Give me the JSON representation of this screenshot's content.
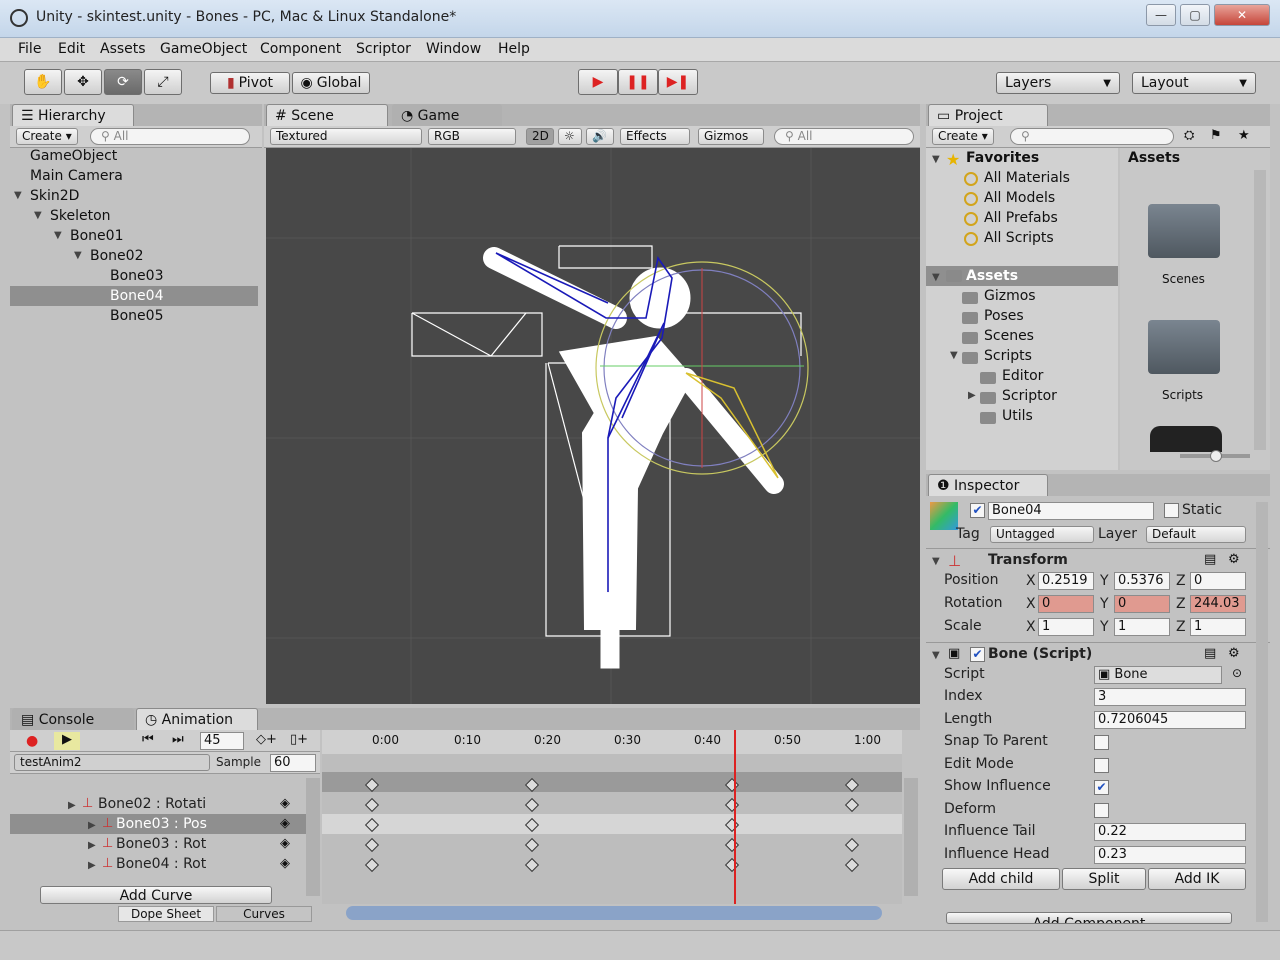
{
  "window": {
    "title": "Unity - skintest.unity - Bones - PC, Mac & Linux Standalone*",
    "min": "—",
    "max": "▢",
    "close": "✕"
  },
  "menu": [
    "File",
    "Edit",
    "Assets",
    "GameObject",
    "Component",
    "Scriptor",
    "Window",
    "Help"
  ],
  "toolbar": {
    "pivot": "Pivot",
    "global": "Global",
    "layers": "Layers",
    "layout": "Layout"
  },
  "hierarchy": {
    "tab": "Hierarchy",
    "create": "Create ▾",
    "search_placeholder": "All",
    "items": [
      {
        "label": "GameObject"
      },
      {
        "label": "Main Camera"
      },
      {
        "label": "Skin2D"
      },
      {
        "label": "Skeleton"
      },
      {
        "label": "Bone01"
      },
      {
        "label": "Bone02"
      },
      {
        "label": "Bone03"
      },
      {
        "label": "Bone04"
      },
      {
        "label": "Bone05"
      }
    ]
  },
  "scene": {
    "tab_scene": "Scene",
    "tab_game": "Game",
    "shading": "Textured",
    "render": "RGB",
    "mode2d": "2D",
    "effects": "Effects",
    "gizmos": "Gizmos",
    "search_placeholder": "All"
  },
  "project": {
    "tab": "Project",
    "create": "Create ▾",
    "favorites": "Favorites",
    "favorite_items": [
      "All Materials",
      "All Models",
      "All Prefabs",
      "All Scripts"
    ],
    "assets_root": "Assets",
    "folders": [
      "Gizmos",
      "Poses",
      "Scenes",
      "Scripts",
      "Editor",
      "Scriptor",
      "Utils"
    ],
    "breadcrumb": "Assets",
    "grid": [
      "Scenes",
      "Scripts"
    ]
  },
  "inspector": {
    "tab": "Inspector",
    "name": "Bone04",
    "static": "Static",
    "tag_label": "Tag",
    "tag": "Untagged",
    "layer_label": "Layer",
    "layer": "Default",
    "transform": {
      "title": "Transform",
      "position_label": "Position",
      "position": {
        "x": "0.2519",
        "y": "0.5376",
        "z": "0"
      },
      "rotation_label": "Rotation",
      "rotation": {
        "x": "0",
        "y": "0",
        "z": "244.03"
      },
      "scale_label": "Scale",
      "scale": {
        "x": "1",
        "y": "1",
        "z": "1"
      },
      "x": "X",
      "y": "Y",
      "z": "Z"
    },
    "bone": {
      "title": "Bone (Script)",
      "script_label": "Script",
      "script": "Bone",
      "index_label": "Index",
      "index": "3",
      "length_label": "Length",
      "length": "0.7206045",
      "snap_label": "Snap To Parent",
      "snap": false,
      "edit_label": "Edit Mode",
      "edit": false,
      "show_label": "Show Influence",
      "show": true,
      "deform_label": "Deform",
      "deform": false,
      "tail_label": "Influence Tail",
      "tail": "0.22",
      "head_label": "Influence Head",
      "head": "0.23"
    },
    "buttons": {
      "add_child": "Add child",
      "split": "Split",
      "add_ik": "Add IK",
      "add_component": "Add Component"
    }
  },
  "animation": {
    "tab_console": "Console",
    "tab_anim": "Animation",
    "frame": "45",
    "clip": "testAnim2",
    "sample_label": "Sample",
    "sample": "60",
    "ticks": [
      "0:00",
      "0:10",
      "0:20",
      "0:30",
      "0:40",
      "0:50",
      "1:00"
    ],
    "tracks": [
      "Bone02 : Rotati",
      "Bone03 : Pos",
      "Bone03 : Rot",
      "Bone04 : Rot"
    ],
    "add_curve": "Add Curve",
    "dope_sheet": "Dope Sheet",
    "curves": "Curves",
    "playhead_fraction": 0.73
  }
}
